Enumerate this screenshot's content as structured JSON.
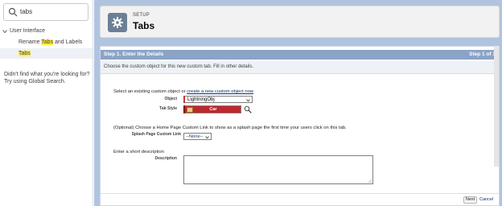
{
  "search": {
    "value": "tabs"
  },
  "tree": {
    "parent": "User Interface",
    "items": [
      {
        "pre": "Rename ",
        "hl": "Tabs",
        "post": " and Labels"
      },
      {
        "pre": "",
        "hl": "Tabs",
        "post": ""
      }
    ]
  },
  "noresult": "Didn't find what you're looking for? Try using Global Search.",
  "header": {
    "eyebrow": "SETUP",
    "title": "Tabs"
  },
  "step": {
    "title": "Step 1. Enter the Details",
    "progress": "Step 1 of 3",
    "subtitle": "Choose the custom object for this new custom tab. Fill in other details."
  },
  "form": {
    "intro_pre": "Select an existing custom object or ",
    "intro_link": "create a new custom object now",
    "object_label": "Object",
    "object_value": "LightningObj",
    "tabstyle_label": "Tab Style",
    "tabstyle_value": "Car",
    "splash_intro": "(Optional) Choose a Home Page Custom Link to show as a splash page the first time your users click on this tab.",
    "splash_label": "Splash Page Custom Link",
    "splash_value": "--None--",
    "desc_intro": "Enter a short description",
    "desc_label": "Description"
  },
  "actions": {
    "next": "Next",
    "cancel": "Cancel"
  },
  "colors": {
    "tab_style": "#c1272d",
    "step_bar": "#8ba3c7",
    "page_bg": "#b0c4df"
  }
}
